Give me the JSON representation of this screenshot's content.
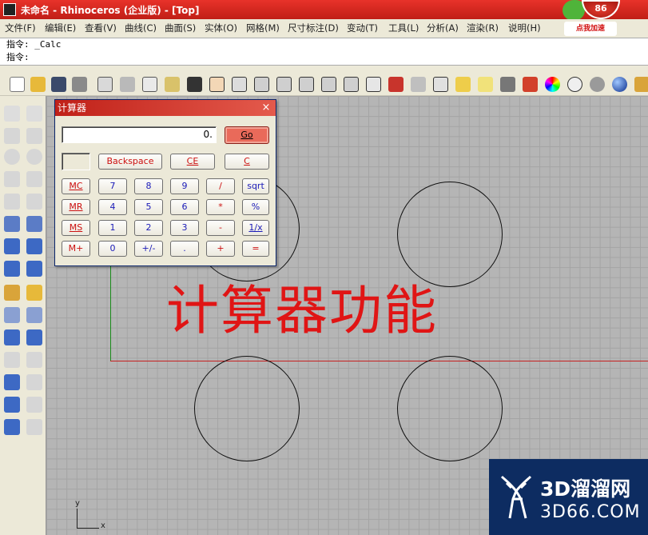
{
  "window": {
    "title": "未命名 - Rhinoceros (企业版) - [Top]",
    "badge": "86",
    "boost_label": "点我加速"
  },
  "menu": [
    "文件(F)",
    "编辑(E)",
    "查看(V)",
    "曲线(C)",
    "曲面(S)",
    "实体(O)",
    "网格(M)",
    "尺寸标注(D)",
    "变动(T)",
    "工具(L)",
    "分析(A)",
    "渲染(R)",
    "说明(H)"
  ],
  "command": {
    "history": "指令: _Calc",
    "prompt": "指令:"
  },
  "viewport": {
    "overlay_text": "计算器功能",
    "axis_y": "y",
    "axis_x": "x"
  },
  "calculator": {
    "title": "计算器",
    "close": "×",
    "display": "0.",
    "go": "Go",
    "backspace": "Backspace",
    "ce": "CE",
    "c": "C",
    "keys": [
      [
        "MC",
        "7",
        "8",
        "9",
        "/",
        "sqrt"
      ],
      [
        "MR",
        "4",
        "5",
        "6",
        "*",
        "%"
      ],
      [
        "MS",
        "1",
        "2",
        "3",
        "-",
        "1/x"
      ],
      [
        "M+",
        "0",
        "+/-",
        ".",
        "+",
        "="
      ]
    ]
  },
  "watermark": {
    "main": "3D溜溜网",
    "sub": "3D66.COM"
  },
  "colors": {
    "title_bar": "#c01e16",
    "viewport_bg": "#b5b5b5",
    "grid_line": "#a4a4a4",
    "x_axis": "#c62020",
    "y_axis": "#1a8a1a",
    "overlay_text": "#e01515",
    "watermark_bg": "#0d2c61",
    "calc_go": "#e96a5a"
  }
}
